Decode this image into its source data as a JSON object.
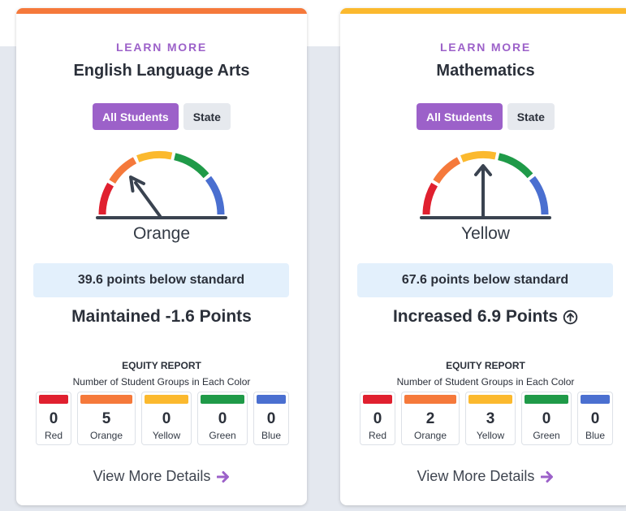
{
  "cards": [
    {
      "key": "ela",
      "accent_color": "#f5793b",
      "learn_more": "LEARN MORE",
      "title": "English Language Arts",
      "toggle": {
        "active": "All Students",
        "inactive": "State"
      },
      "gauge": {
        "level": "orange",
        "needle_icon": "gauge-needle"
      },
      "status": "Orange",
      "standard": "39.6 points below standard",
      "change": "Maintained -1.6 Points",
      "change_icon": null,
      "equity": {
        "title": "EQUITY REPORT",
        "subtitle": "Number of Student Groups in Each Color",
        "groups": [
          {
            "label": "Red",
            "count": "0",
            "color": "#e0202f"
          },
          {
            "label": "Orange",
            "count": "5",
            "color": "#f5793b"
          },
          {
            "label": "Yellow",
            "count": "0",
            "color": "#fbb92e"
          },
          {
            "label": "Green",
            "count": "0",
            "color": "#1f9a48"
          },
          {
            "label": "Blue",
            "count": "0",
            "color": "#4a6fd0"
          }
        ]
      },
      "details": "View More Details"
    },
    {
      "key": "math",
      "accent_color": "#fbb92e",
      "learn_more": "LEARN MORE",
      "title": "Mathematics",
      "toggle": {
        "active": "All Students",
        "inactive": "State"
      },
      "gauge": {
        "level": "yellow",
        "needle_icon": "gauge-needle"
      },
      "status": "Yellow",
      "standard": "67.6 points below standard",
      "change": "Increased 6.9 Points",
      "change_icon": "arrow-up-circle-icon",
      "equity": {
        "title": "EQUITY REPORT",
        "subtitle": "Number of Student Groups in Each Color",
        "groups": [
          {
            "label": "Red",
            "count": "0",
            "color": "#e0202f"
          },
          {
            "label": "Orange",
            "count": "2",
            "color": "#f5793b"
          },
          {
            "label": "Yellow",
            "count": "3",
            "color": "#fbb92e"
          },
          {
            "label": "Green",
            "count": "0",
            "color": "#1f9a48"
          },
          {
            "label": "Blue",
            "count": "0",
            "color": "#4a6fd0"
          }
        ]
      },
      "details": "View More Details"
    }
  ],
  "colors": {
    "link_purple": "#9c61c9",
    "text_dark": "#2b303a",
    "standard_bg": "#e3f0fc",
    "page_band": "#e4e8ef"
  }
}
